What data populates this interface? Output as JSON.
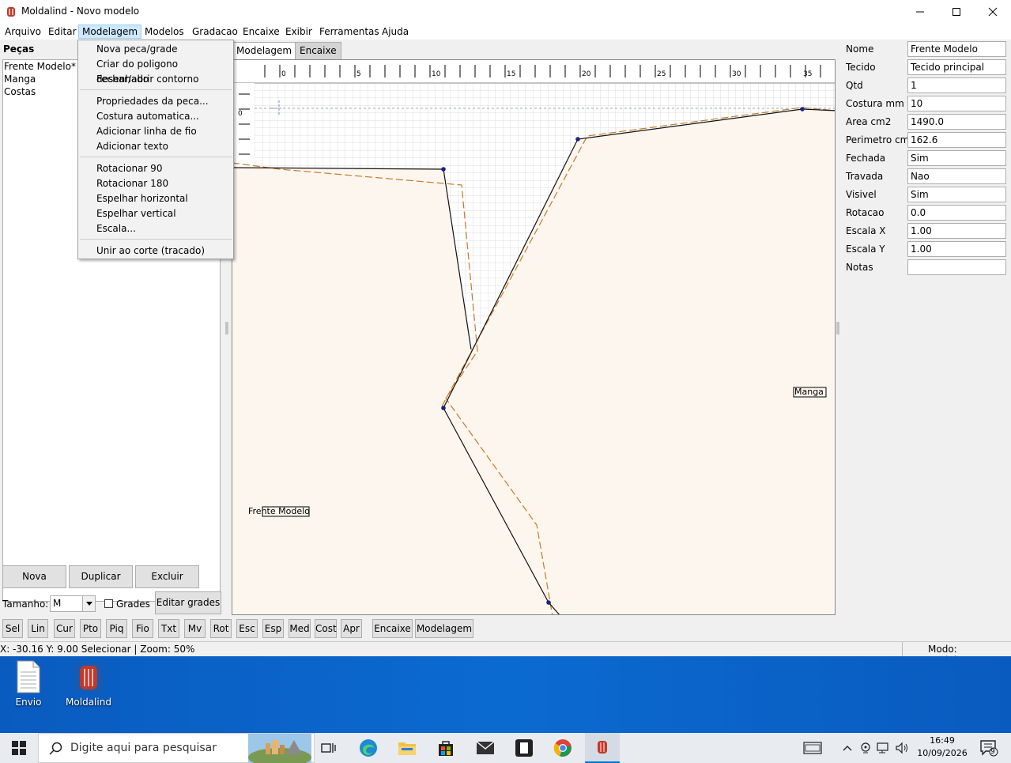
{
  "window": {
    "title": "Moldalind - Novo modelo"
  },
  "menubar": {
    "items": [
      "Arquivo",
      "Editar",
      "Modelagem",
      "Modelos",
      "Gradacao",
      "Encaixe",
      "Exibir",
      "Ferramentas",
      "Ajuda"
    ],
    "active": "Modelagem"
  },
  "dropdown": {
    "items": [
      "Nova peca/grade",
      "Criar do poligono desenhado",
      "Fechar/abrir contorno",
      "Propriedades da peca...",
      "Costura automatica...",
      "Adicionar linha de fio",
      "Adicionar texto",
      "Rotacionar 90",
      "Rotacionar 180",
      "Espelhar horizontal",
      "Espelhar vertical",
      "Escala...",
      "Unir ao corte (tracado)"
    ]
  },
  "left_panel": {
    "heading": "Peças",
    "pieces": [
      "Frente Modelo*",
      "Manga",
      "Costas"
    ],
    "btn_new": "Nova",
    "btn_duplicate": "Duplicar",
    "btn_delete": "Excluir",
    "size_label": "Tamanho:",
    "size_value": "M",
    "grades_label": "Grades",
    "btn_edit_grades": "Editar grades"
  },
  "tabs": {
    "modelagem": "Modelagem",
    "encaixe": "Encaixe"
  },
  "canvas": {
    "ruler_labels": [
      "0",
      "5",
      "10",
      "15",
      "20",
      "25",
      "30",
      "35"
    ],
    "left_ruler_label": "0",
    "piece_label_1": "Frente Modelo",
    "piece_label_2": "Manga"
  },
  "properties": {
    "labels": {
      "nome": "Nome",
      "tecido": "Tecido",
      "qtd": "Qtd",
      "costura": "Costura mm",
      "area": "Area cm2",
      "perimetro": "Perimetro cm",
      "fechada": "Fechada",
      "travada": "Travada",
      "visivel": "Visivel",
      "rotacao": "Rotacao",
      "escala_x": "Escala X",
      "escala_y": "Escala Y",
      "notas": "Notas"
    },
    "values": {
      "nome": "Frente Modelo",
      "tecido": "Tecido principal",
      "qtd": "1",
      "costura": "10",
      "area": "1490.0",
      "perimetro": "162.6",
      "fechada": "Sim",
      "travada": "Nao",
      "visivel": "Sim",
      "rotacao": "0.0",
      "escala_x": "1.00",
      "escala_y": "1.00",
      "notas": ""
    }
  },
  "toolbar": {
    "tools": [
      "Sel",
      "Lin",
      "Cur",
      "Pto",
      "Piq",
      "Fio",
      "Txt",
      "Mv",
      "Rot",
      "Esc",
      "Esp",
      "Med",
      "Cost",
      "Apr"
    ],
    "mode_buttons": [
      "Encaixe",
      "Modelagem"
    ]
  },
  "status": {
    "left": "X: -30.16  Y: 9.00  Selecionar  |  Zoom: 50%",
    "right": "Modo: Modelagem"
  },
  "desktop": {
    "icons": [
      "Envio",
      "Moldalind"
    ]
  },
  "taskbar": {
    "search_placeholder": "Digite aqui para pesquisar",
    "time": "16:49",
    "date": "10/09/2026",
    "notification_count": "9"
  },
  "colors": {
    "piece_fill": "#fdf6ee",
    "seam_dash": "#c87a2a",
    "accent": "#0078d7"
  }
}
